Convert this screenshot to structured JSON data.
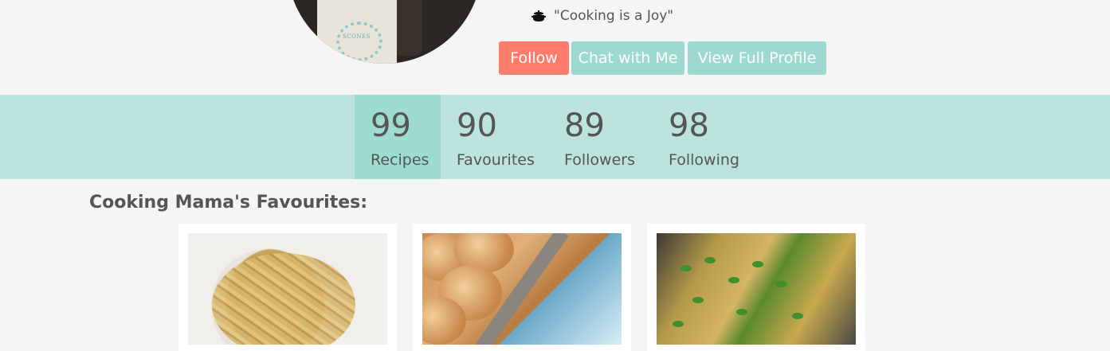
{
  "profile": {
    "quote": "\"Cooking is a Joy\"",
    "quote_icon": "cooking-pot-icon",
    "avatar_bag_text": "SCONES"
  },
  "actions": {
    "follow_label": "Follow",
    "chat_label": "Chat with Me",
    "view_profile_label": "View Full Profile"
  },
  "stats": [
    {
      "value": "99",
      "label": "Recipes",
      "active": true
    },
    {
      "value": "90",
      "label": "Favourites",
      "active": false
    },
    {
      "value": "89",
      "label": "Followers",
      "active": false
    },
    {
      "value": "98",
      "label": "Following",
      "active": false
    }
  ],
  "favourites": {
    "title": "Cooking Mama's Favourites:",
    "items": [
      {
        "image": "pasta-dish-photo"
      },
      {
        "image": "baked-buns-photo"
      },
      {
        "image": "baked-tray-with-herbs-photo"
      }
    ]
  },
  "colors": {
    "follow": "#ff7b6b",
    "secondary_button": "#9ed9d0",
    "stats_bar": "#bde3de",
    "stats_active": "#9edbd1",
    "background": "#f5f5f5"
  }
}
